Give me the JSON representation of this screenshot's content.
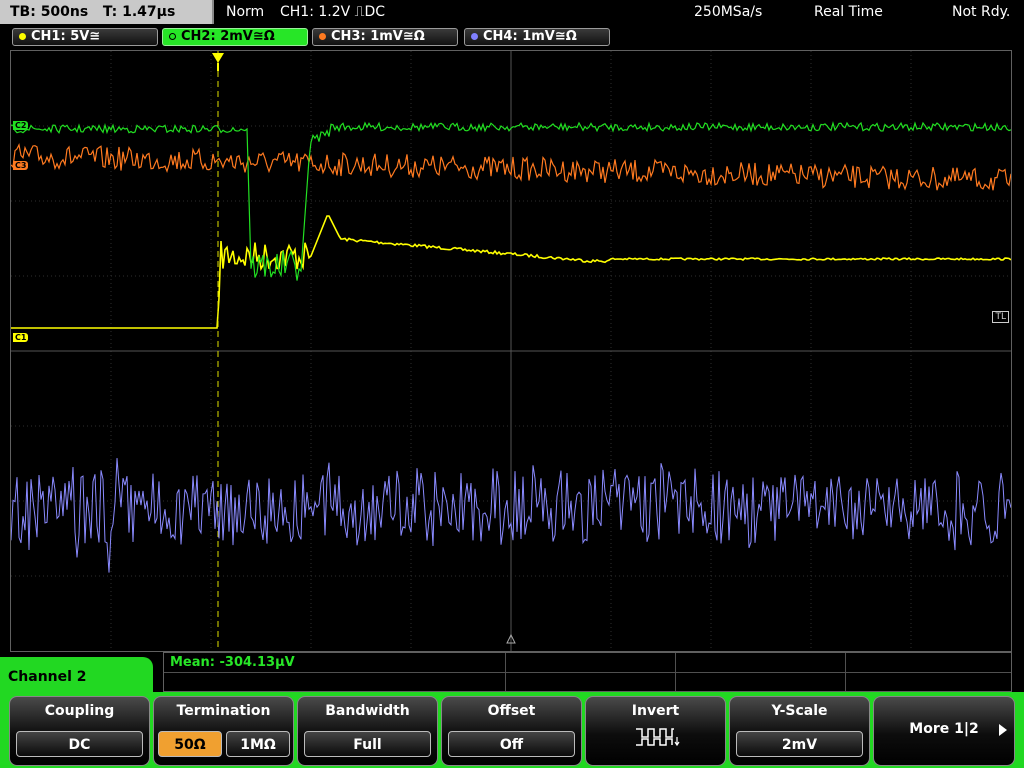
{
  "status": {
    "timebase": "TB: 500ns",
    "trigger_time": "T: 1.47µs",
    "mode": "Norm",
    "trigger_info": "CH1: 1.2V ⎍DC",
    "sample_rate": "250MSa/s",
    "acquisition": "Real Time",
    "state": "Not Rdy."
  },
  "channels": [
    {
      "label": "CH1: 5V≅",
      "color": "#ffff00"
    },
    {
      "label": "CH2: 2mV≅Ω",
      "color": "#22e022"
    },
    {
      "label": "CH3: 1mV≅Ω",
      "color": "#ff7a20"
    },
    {
      "label": "CH4: 1mV≅Ω",
      "color": "#8080ff"
    }
  ],
  "markers": {
    "c1": "C1",
    "c3": "C3",
    "c2": "C2",
    "tl": "TL"
  },
  "measurement": {
    "mean": "Mean: -304.13µV"
  },
  "menu": {
    "channel_label": "Channel 2",
    "coupling": {
      "title": "Coupling",
      "value": "DC"
    },
    "termination": {
      "title": "Termination",
      "opt1": "50Ω",
      "opt2": "1MΩ"
    },
    "bandwidth": {
      "title": "Bandwidth",
      "value": "Full"
    },
    "offset": {
      "title": "Offset",
      "value": "Off"
    },
    "invert": {
      "title": "Invert"
    },
    "yscale": {
      "title": "Y-Scale",
      "value": "2mV"
    },
    "more": {
      "label": "More 1|2"
    }
  }
}
